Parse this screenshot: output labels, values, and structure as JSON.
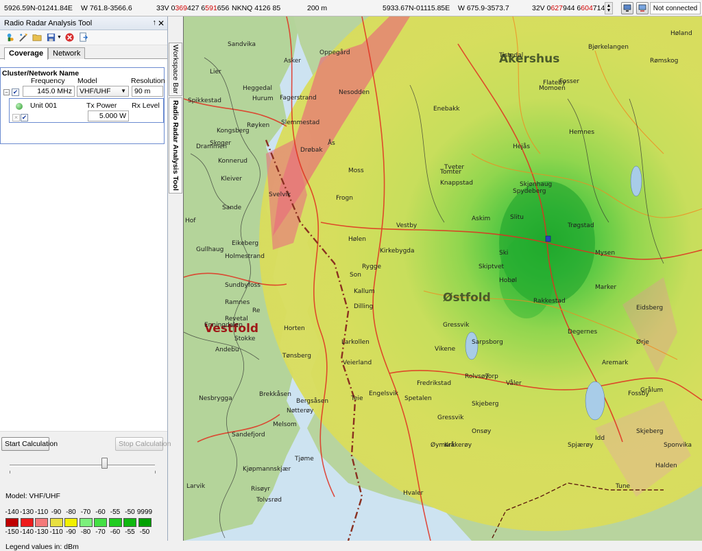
{
  "statusbar": {
    "coord1": "5926.59N-01241.84E",
    "coord2": "W 761.8-3566.6",
    "utm1_prefix": "33V 0",
    "utm1_red1": "369",
    "utm1_mid": "427 6",
    "utm1_red2": "591",
    "utm1_end": "656",
    "mgrs": "NKNQ 4126 85",
    "distance": "200 m",
    "coord3": "5933.67N-01115.85E",
    "coord4": "W 675.9-3573.7",
    "utm2_prefix": "32V 0",
    "utm2_red1": "627",
    "utm2_mid": "944 6",
    "utm2_red2": "604",
    "utm2_end": "714",
    "connection": "Not connected"
  },
  "panel": {
    "title": "Radio Radar Analysis Tool",
    "pin": "↑",
    "close": "✕",
    "tabs": [
      {
        "label": "Coverage",
        "active": true
      },
      {
        "label": "Network",
        "active": false
      }
    ],
    "cluster": {
      "name_label": "Cluster/Network Name",
      "frequency_label": "Frequency",
      "model_label": "Model",
      "resolution_label": "Resolution",
      "frequency_value": "145.0 MHz",
      "model_value": "VHF/UHF",
      "resolution_value": "90 m"
    },
    "unit": {
      "name": "Unit 001",
      "tx_power_label": "Tx Power",
      "rx_level_label": "Rx Level",
      "tx_power_value": "5.000 W"
    },
    "start_button": "Start Calculation",
    "stop_button": "Stop Calculation",
    "model_text": "Model: VHF/UHF",
    "legend_top": [
      "-140",
      "-130",
      "-110",
      "-90",
      "-80",
      "-70",
      "-60",
      "-55",
      "-50",
      "9999"
    ],
    "legend_bottom": [
      "-150",
      "-140",
      "-130",
      "-110",
      "-90",
      "-80",
      "-70",
      "-60",
      "-55",
      "-50"
    ],
    "legend_colors": [
      "#c00000",
      "#ee1c1c",
      "#f47a7a",
      "#e8e040",
      "#f2f000",
      "#7cf07c",
      "#44e044",
      "#20cc20",
      "#10b810",
      "#00a000"
    ],
    "legend_units": "Legend values in: dBm"
  },
  "workspace": {
    "tab1": "Workspace Bar",
    "tab2": "Radio Radar Analysis Tool"
  },
  "map": {
    "labels": [
      {
        "text": "Akershus",
        "cls": "region"
      },
      {
        "text": "Vestfold",
        "cls": "county"
      },
      {
        "text": "Østfold",
        "cls": "region"
      },
      {
        "text": "Drammen",
        "cls": "town"
      },
      {
        "text": "Lier",
        "cls": "town"
      },
      {
        "text": "Asker",
        "cls": "town"
      },
      {
        "text": "Holmestrand",
        "cls": "town"
      },
      {
        "text": "Horten",
        "cls": "town"
      },
      {
        "text": "Tønsberg",
        "cls": "town"
      },
      {
        "text": "Sandefjord",
        "cls": "town"
      },
      {
        "text": "Moss",
        "cls": "town"
      },
      {
        "text": "Halden",
        "cls": "town"
      },
      {
        "text": "Fredrikstad",
        "cls": "town"
      },
      {
        "text": "Sarpsborg",
        "cls": "town"
      },
      {
        "text": "Askim",
        "cls": "town"
      },
      {
        "text": "Mysen",
        "cls": "town"
      },
      {
        "text": "Ski",
        "cls": "town"
      },
      {
        "text": "Spydeberg",
        "cls": "town"
      },
      {
        "text": "Rakkestad",
        "cls": "town"
      },
      {
        "text": "Enebakk",
        "cls": "town"
      },
      {
        "text": "Hobøl",
        "cls": "town"
      },
      {
        "text": "Skjeberg",
        "cls": "town"
      },
      {
        "text": "Hvaler",
        "cls": "town"
      },
      {
        "text": "Larkollen",
        "cls": "town"
      },
      {
        "text": "Rygge",
        "cls": "town"
      },
      {
        "text": "Våler",
        "cls": "town"
      },
      {
        "text": "Marker",
        "cls": "town"
      },
      {
        "text": "Aremark",
        "cls": "town"
      },
      {
        "text": "Degernes",
        "cls": "town"
      },
      {
        "text": "Skiptvet",
        "cls": "town"
      },
      {
        "text": "Tveter",
        "cls": "town"
      },
      {
        "text": "Sande",
        "cls": "town"
      },
      {
        "text": "Svelvik",
        "cls": "town"
      },
      {
        "text": "Hurum",
        "cls": "town"
      },
      {
        "text": "Stokke",
        "cls": "town"
      },
      {
        "text": "Nøtterøy",
        "cls": "town"
      },
      {
        "text": "Tjøme",
        "cls": "town"
      },
      {
        "text": "Larvik",
        "cls": "town"
      },
      {
        "text": "Hof",
        "cls": "town"
      },
      {
        "text": "Andebu",
        "cls": "town"
      },
      {
        "text": "Re",
        "cls": "town"
      },
      {
        "text": "Kirkebygda",
        "cls": "town"
      },
      {
        "text": "Hølen",
        "cls": "town"
      },
      {
        "text": "Son",
        "cls": "town"
      },
      {
        "text": "Dilling",
        "cls": "town"
      },
      {
        "text": "Kallum",
        "cls": "town"
      },
      {
        "text": "Fosser",
        "cls": "town"
      },
      {
        "text": "Flateby",
        "cls": "town"
      },
      {
        "text": "Momoen",
        "cls": "town"
      },
      {
        "text": "Hemnes",
        "cls": "town"
      },
      {
        "text": "Hejås",
        "cls": "town"
      },
      {
        "text": "Knappstad",
        "cls": "town"
      },
      {
        "text": "Tomter",
        "cls": "town"
      },
      {
        "text": "Slitu",
        "cls": "town"
      },
      {
        "text": "Skjønhaug",
        "cls": "town"
      },
      {
        "text": "Trøgstad",
        "cls": "town"
      },
      {
        "text": "Ørje",
        "cls": "town"
      },
      {
        "text": "Øymark",
        "cls": "town"
      },
      {
        "text": "Rømskog",
        "cls": "town"
      },
      {
        "text": "Fossby",
        "cls": "town"
      },
      {
        "text": "Bjørkelangen",
        "cls": "town"
      },
      {
        "text": "Høland",
        "cls": "town"
      },
      {
        "text": "Kråkerøy",
        "cls": "town"
      },
      {
        "text": "Idd",
        "cls": "town"
      },
      {
        "text": "Spjærøy",
        "cls": "town"
      },
      {
        "text": "Gressvik",
        "cls": "town"
      },
      {
        "text": "Onsøy",
        "cls": "town"
      },
      {
        "text": "Eidsberg",
        "cls": "town"
      },
      {
        "text": "Vestby",
        "cls": "town"
      },
      {
        "text": "Drøbak",
        "cls": "town"
      },
      {
        "text": "Frogn",
        "cls": "town"
      },
      {
        "text": "Ås",
        "cls": "town"
      },
      {
        "text": "Nesodden",
        "cls": "town"
      },
      {
        "text": "Oppegård",
        "cls": "town"
      },
      {
        "text": "Sandvika",
        "cls": "town"
      },
      {
        "text": "Fagerstrand",
        "cls": "town"
      },
      {
        "text": "Heggedal",
        "cls": "town"
      },
      {
        "text": "Slemmestad",
        "cls": "town"
      },
      {
        "text": "Røyken",
        "cls": "town"
      },
      {
        "text": "Spikkestad",
        "cls": "town"
      },
      {
        "text": "Kongsberg",
        "cls": "town"
      },
      {
        "text": "Skoger",
        "cls": "town"
      },
      {
        "text": "Konnerud",
        "cls": "town"
      },
      {
        "text": "Kleiver",
        "cls": "town"
      },
      {
        "text": "Eikeberg",
        "cls": "town"
      },
      {
        "text": "Gullhaug",
        "cls": "town"
      },
      {
        "text": "Sundbyfoss",
        "cls": "town"
      },
      {
        "text": "Ramnes",
        "cls": "town"
      },
      {
        "text": "Revetal",
        "cls": "town"
      },
      {
        "text": "Brekkåsen",
        "cls": "town"
      },
      {
        "text": "Bergsåsen",
        "cls": "town"
      },
      {
        "text": "Melsom",
        "cls": "town"
      },
      {
        "text": "Nesbrygga",
        "cls": "town"
      },
      {
        "text": "Kjøpmannskjær",
        "cls": "town"
      },
      {
        "text": "Risøyr",
        "cls": "town"
      },
      {
        "text": "Tolvsrød",
        "cls": "town"
      },
      {
        "text": "Teie",
        "cls": "town"
      },
      {
        "text": "Veierland",
        "cls": "town"
      },
      {
        "text": "Engelsvik",
        "cls": "town"
      },
      {
        "text": "Spetalen",
        "cls": "town"
      },
      {
        "text": "Vikene",
        "cls": "town"
      },
      {
        "text": "Gressvik",
        "cls": "town"
      },
      {
        "text": "Rolvsøy",
        "cls": "town"
      },
      {
        "text": "Torp",
        "cls": "town"
      },
      {
        "text": "Grålum",
        "cls": "town"
      },
      {
        "text": "Tune",
        "cls": "town"
      },
      {
        "text": "Skjeberg",
        "cls": "town"
      },
      {
        "text": "Sponvika",
        "cls": "town"
      },
      {
        "text": "Tistedal",
        "cls": "town"
      },
      {
        "text": "Enningdalen",
        "cls": "town"
      }
    ]
  }
}
